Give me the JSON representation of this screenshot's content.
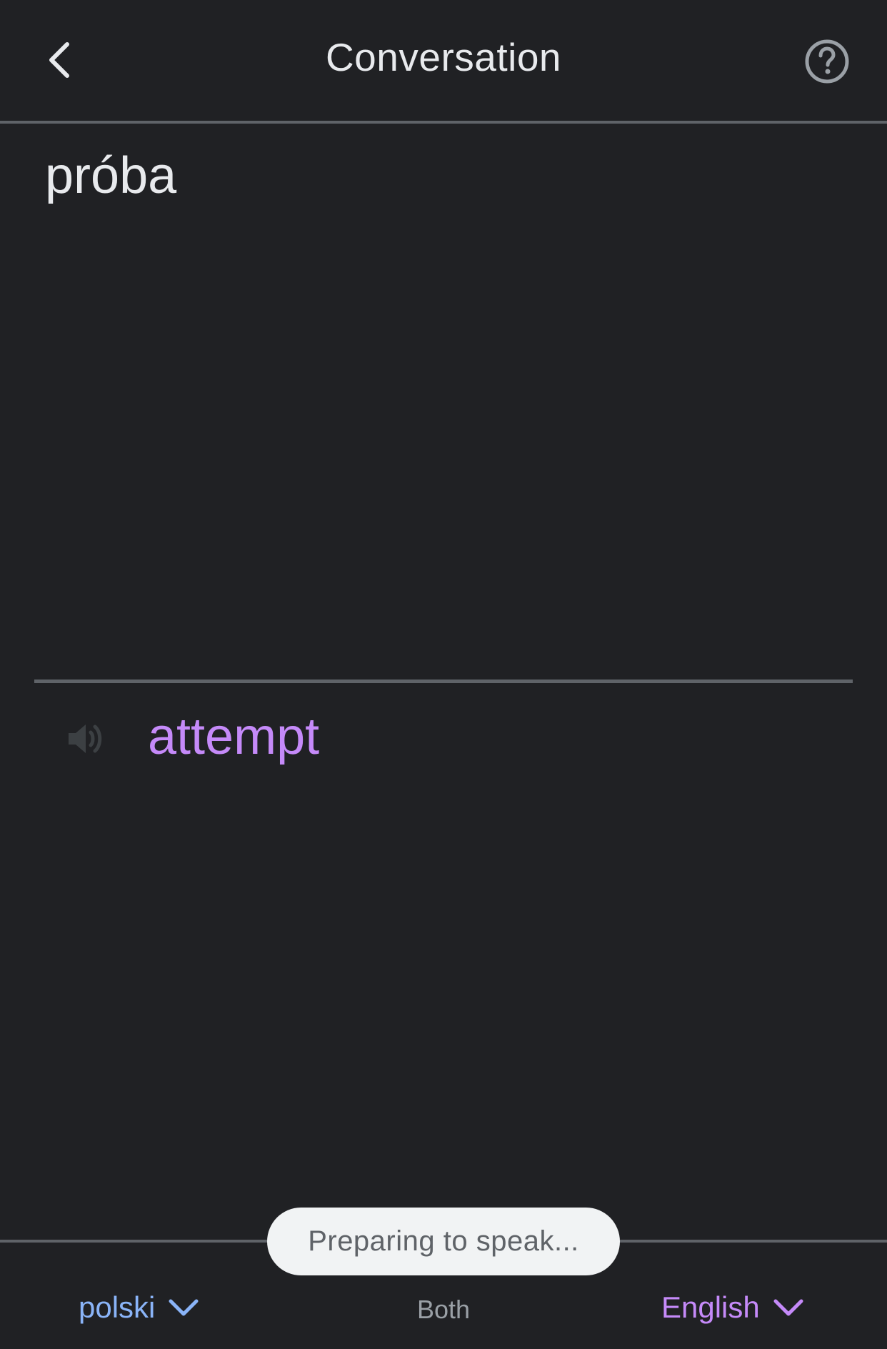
{
  "header": {
    "title": "Conversation",
    "back_icon": "chevron-left-icon",
    "help_icon": "help-circle-icon"
  },
  "source": {
    "text": "próba"
  },
  "translation": {
    "text": "attempt",
    "speaker_icon": "speaker-icon"
  },
  "toast": {
    "text": "Preparing to speak..."
  },
  "bottom_bar": {
    "left_language": "polski",
    "mode": "Both",
    "right_language": "English"
  },
  "colors": {
    "background": "#202124",
    "divider": "#5f6368",
    "source_language": "#8ab4f8",
    "target_language": "#c58af9",
    "toast_background": "#f1f3f4"
  }
}
